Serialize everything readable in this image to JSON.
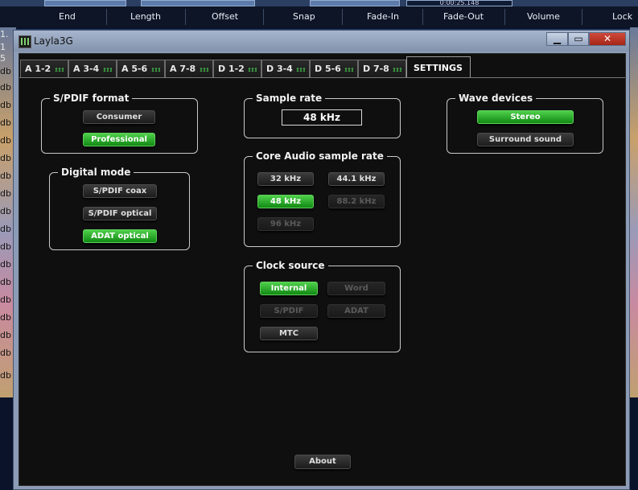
{
  "daw": {
    "header": {
      "columns": [
        "End",
        "Length",
        "Offset",
        "Snap",
        "Fade-In",
        "Fade-Out",
        "Volume",
        "Lock"
      ],
      "timecode": "0:00:25.148"
    },
    "track_labels": [
      "1.",
      "1",
      "5",
      "db",
      "db",
      "db",
      "db",
      "db",
      "db",
      "db",
      "db",
      "db",
      "db",
      "db",
      "db",
      "db",
      "db",
      "db",
      "db",
      "db",
      "db"
    ]
  },
  "window": {
    "title": "Layla3G",
    "controls": {
      "minimize": "▁",
      "maximize": "▭",
      "close": "✕"
    }
  },
  "tabs": [
    {
      "label": "A 1-2"
    },
    {
      "label": "A 3-4"
    },
    {
      "label": "A 5-6"
    },
    {
      "label": "A 7-8"
    },
    {
      "label": "D 1-2"
    },
    {
      "label": "D 3-4"
    },
    {
      "label": "D 5-6"
    },
    {
      "label": "D 7-8"
    },
    {
      "label": "SETTINGS"
    }
  ],
  "settings": {
    "spdif_format": {
      "title": "S/PDIF format",
      "consumer": "Consumer",
      "professional": "Professional",
      "selected": "Professional"
    },
    "digital_mode": {
      "title": "Digital mode",
      "coax": "S/PDIF coax",
      "optical": "S/PDIF optical",
      "adat": "ADAT optical",
      "selected": "ADAT optical"
    },
    "sample_rate": {
      "title": "Sample rate",
      "value": "48 kHz"
    },
    "core_audio": {
      "title": "Core Audio sample rate",
      "r32": "32 kHz",
      "r441": "44.1 kHz",
      "r48": "48 kHz",
      "r882": "88.2 kHz",
      "r96": "96 kHz",
      "selected": "48 kHz"
    },
    "clock_source": {
      "title": "Clock source",
      "internal": "Internal",
      "word": "Word",
      "spdif": "S/PDIF",
      "adat": "ADAT",
      "mtc": "MTC",
      "selected": "Internal"
    },
    "wave_devices": {
      "title": "Wave devices",
      "stereo": "Stereo",
      "surround": "Surround sound",
      "selected": "Stereo"
    },
    "about": "About"
  },
  "colors": {
    "accent_green": "#2fb832",
    "panel_bg": "#0f0f10",
    "window_frame": "#8c9cb6"
  }
}
